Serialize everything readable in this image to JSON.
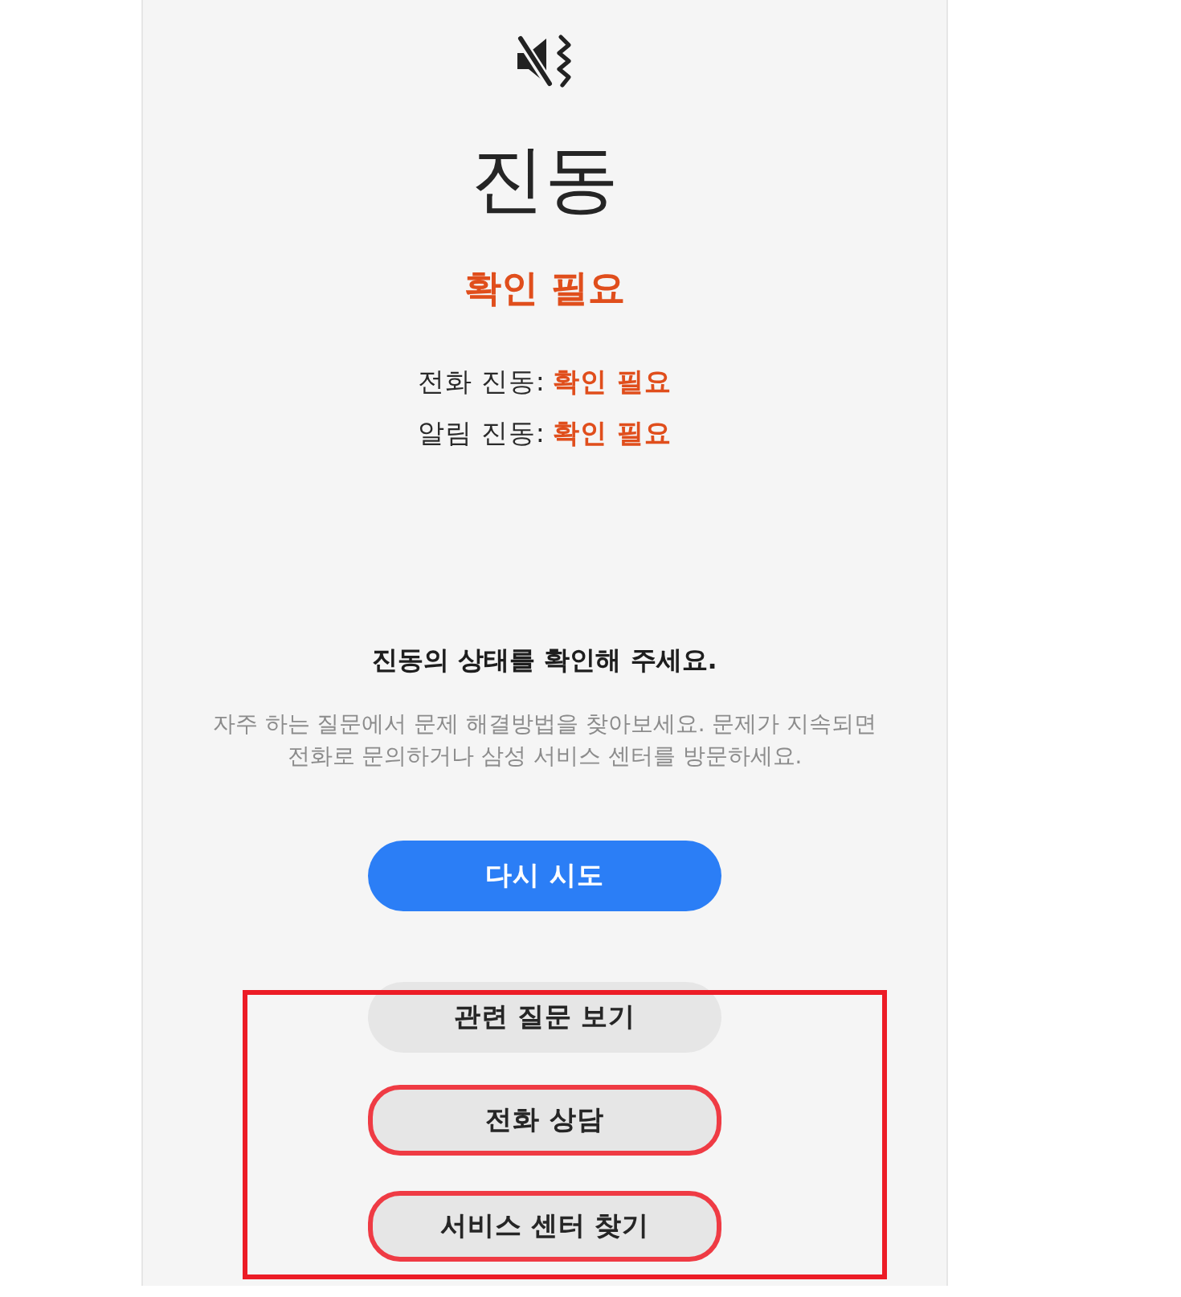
{
  "screen": {
    "title": "진동",
    "status": "확인 필요"
  },
  "details": [
    {
      "label": "전화 진동:",
      "value": "확인 필요"
    },
    {
      "label": "알림 진동:",
      "value": "확인 필요"
    }
  ],
  "message": {
    "heading": "진동의 상태를 확인해 주세요.",
    "body": "자주 하는 질문에서 문제 해결방법을 찾아보세요. 문제가 지속되면 전화로 문의하거나 삼성 서비스 센터를 방문하세요."
  },
  "buttons": [
    {
      "label": "다시 시도",
      "kind": "primary",
      "highlighted": false
    },
    {
      "label": "관련 질문 보기",
      "kind": "secondary",
      "highlighted": false
    },
    {
      "label": "전화 상담",
      "kind": "secondary",
      "highlighted": true
    },
    {
      "label": "서비스 센터 찾기",
      "kind": "secondary",
      "highlighted": true
    }
  ],
  "annotation_frame": true
}
